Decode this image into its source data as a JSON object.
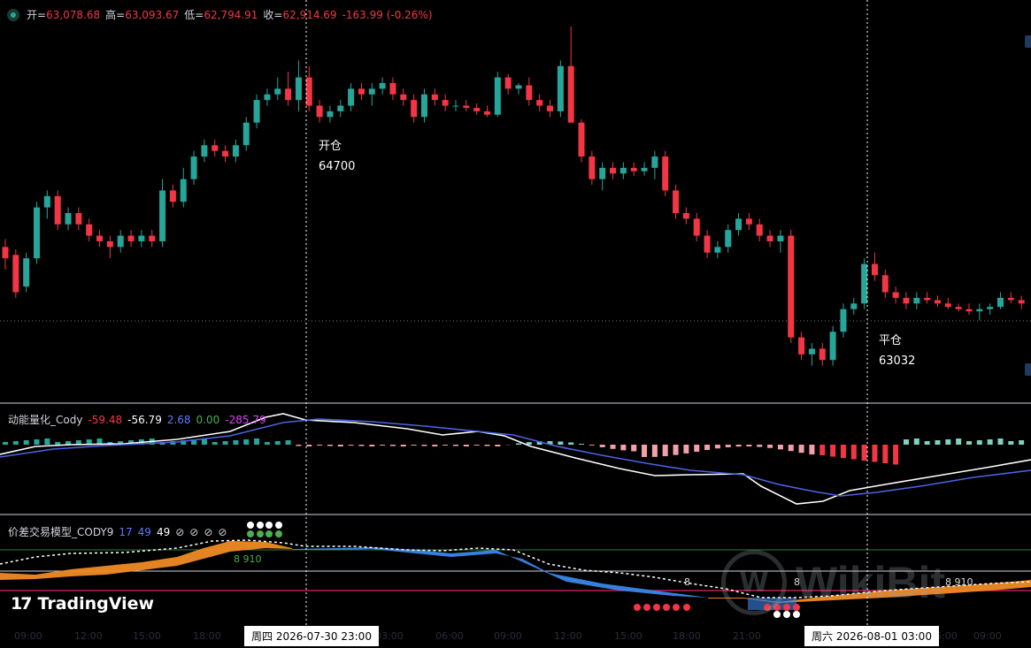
{
  "ohlc": [
    {
      "k": "开=",
      "v": "63,078.68"
    },
    {
      "k": "高=",
      "v": "63,093.67"
    },
    {
      "k": "低=",
      "v": "62,794.91"
    },
    {
      "k": "收=",
      "v": "62,914.69"
    },
    {
      "k": "",
      "v": "-163.99 (-0.26%)"
    }
  ],
  "annotations": {
    "open_label": "开仓",
    "open_price": "64700",
    "close_label": "平仓",
    "close_price": "63032"
  },
  "ind1": {
    "name": "动能量化_Cody",
    "v1": "-59.48",
    "v2": "-56.79",
    "v3": "2.68",
    "v4": "0.00",
    "v5": "-285.79",
    "colors": [
      "#f23645",
      "#ffffff",
      "#5b7bff",
      "#4caf50",
      "#e040fb"
    ]
  },
  "ind2": {
    "name": "价差交易模型_CODY9",
    "p1": "17",
    "p2": "49",
    "p3": "49",
    "icons": [
      "⊘",
      "⊘",
      "⊘",
      "⊘"
    ],
    "num_a": "8 910",
    "num_b": "8",
    "num_c": "8",
    "num_d": "8 910"
  },
  "time_badges": {
    "left": "周四 2026-07-30   23:00",
    "right": "周六 2026-08-01   03:00"
  },
  "axis_labels": [
    "09:00",
    "12:00",
    "15:00",
    "18:00",
    "03:00",
    "06:00",
    "09:00",
    "12:00",
    "15:00",
    "18:00",
    "21:00",
    "06:00",
    "09:00"
  ],
  "branding": {
    "tradingview": "TradingView",
    "wikibit": "WikiBit"
  },
  "colors": {
    "up": "#26a69a",
    "down": "#f23645",
    "background": "#000000"
  },
  "chart_data": {
    "type": "candlestick",
    "candles": [
      [
        63350,
        63420,
        63150,
        63250
      ],
      [
        63280,
        63330,
        62900,
        62950
      ],
      [
        63000,
        63300,
        62950,
        63250
      ],
      [
        63250,
        63750,
        63200,
        63700
      ],
      [
        63700,
        63850,
        63600,
        63800
      ],
      [
        63800,
        63850,
        63500,
        63550
      ],
      [
        63550,
        63700,
        63500,
        63650
      ],
      [
        63650,
        63700,
        63500,
        63550
      ],
      [
        63550,
        63600,
        63400,
        63450
      ],
      [
        63450,
        63500,
        63350,
        63400
      ],
      [
        63400,
        63450,
        63250,
        63350
      ],
      [
        63350,
        63500,
        63300,
        63450
      ],
      [
        63450,
        63500,
        63350,
        63400
      ],
      [
        63400,
        63500,
        63350,
        63450
      ],
      [
        63450,
        63500,
        63350,
        63400
      ],
      [
        63400,
        63950,
        63350,
        63850
      ],
      [
        63850,
        63900,
        63700,
        63750
      ],
      [
        63750,
        64050,
        63700,
        63950
      ],
      [
        63950,
        64200,
        63900,
        64150
      ],
      [
        64150,
        64300,
        64100,
        64250
      ],
      [
        64250,
        64300,
        64150,
        64200
      ],
      [
        64200,
        64250,
        64100,
        64150
      ],
      [
        64150,
        64300,
        64100,
        64250
      ],
      [
        64250,
        64500,
        64200,
        64450
      ],
      [
        64450,
        64700,
        64400,
        64650
      ],
      [
        64650,
        64750,
        64600,
        64700
      ],
      [
        64700,
        64850,
        64650,
        64750
      ],
      [
        64750,
        64900,
        64600,
        64650
      ],
      [
        64650,
        65000,
        64550,
        64850
      ],
      [
        64850,
        64950,
        64550,
        64600
      ],
      [
        64600,
        64650,
        64450,
        64500
      ],
      [
        64500,
        64600,
        64450,
        64550
      ],
      [
        64550,
        64650,
        64500,
        64600
      ],
      [
        64600,
        64800,
        64550,
        64750
      ],
      [
        64750,
        64800,
        64650,
        64700
      ],
      [
        64700,
        64800,
        64600,
        64750
      ],
      [
        64750,
        64850,
        64700,
        64800
      ],
      [
        64800,
        64850,
        64650,
        64700
      ],
      [
        64700,
        64750,
        64600,
        64650
      ],
      [
        64650,
        64700,
        64450,
        64500
      ],
      [
        64500,
        64750,
        64450,
        64700
      ],
      [
        64700,
        64750,
        64600,
        64650
      ],
      [
        64650,
        64700,
        64550,
        64600
      ],
      [
        64600,
        64650,
        64550,
        64600
      ],
      [
        64600,
        64650,
        64550,
        64580
      ],
      [
        64580,
        64620,
        64520,
        64550
      ],
      [
        64550,
        64600,
        64500,
        64520
      ],
      [
        64520,
        64900,
        64500,
        64850
      ],
      [
        64850,
        64880,
        64700,
        64750
      ],
      [
        64750,
        64800,
        64700,
        64780
      ],
      [
        64780,
        64850,
        64600,
        64650
      ],
      [
        64650,
        64700,
        64550,
        64600
      ],
      [
        64600,
        64650,
        64500,
        64550
      ],
      [
        64550,
        65000,
        64500,
        64950
      ],
      [
        64950,
        65300,
        64450,
        64450
      ],
      [
        64450,
        64480,
        64100,
        64150
      ],
      [
        64150,
        64200,
        63900,
        63950
      ],
      [
        63950,
        64100,
        63850,
        64050
      ],
      [
        64050,
        64100,
        63950,
        64000
      ],
      [
        64000,
        64100,
        63950,
        64050
      ],
      [
        64050,
        64100,
        63980,
        64020
      ],
      [
        64020,
        64100,
        63980,
        64050
      ],
      [
        64050,
        64200,
        63950,
        64150
      ],
      [
        64150,
        64200,
        63800,
        63850
      ],
      [
        63850,
        63900,
        63600,
        63650
      ],
      [
        63650,
        63700,
        63550,
        63600
      ],
      [
        63600,
        63650,
        63400,
        63450
      ],
      [
        63450,
        63500,
        63250,
        63300
      ],
      [
        63300,
        63400,
        63250,
        63350
      ],
      [
        63350,
        63550,
        63300,
        63500
      ],
      [
        63500,
        63650,
        63450,
        63600
      ],
      [
        63600,
        63650,
        63500,
        63550
      ],
      [
        63550,
        63600,
        63400,
        63450
      ],
      [
        63450,
        63500,
        63350,
        63400
      ],
      [
        63400,
        63500,
        63300,
        63450
      ],
      [
        63450,
        63500,
        62500,
        62550
      ],
      [
        62550,
        62600,
        62350,
        62400
      ],
      [
        62400,
        62500,
        62300,
        62450
      ],
      [
        62450,
        62500,
        62300,
        62350
      ],
      [
        62350,
        62650,
        62300,
        62600
      ],
      [
        62600,
        62850,
        62550,
        62800
      ],
      [
        62800,
        62900,
        62750,
        62850
      ],
      [
        62850,
        63250,
        62800,
        63200
      ],
      [
        63200,
        63300,
        63050,
        63100
      ],
      [
        63100,
        63150,
        62900,
        62950
      ],
      [
        62950,
        63000,
        62850,
        62900
      ],
      [
        62900,
        62950,
        62800,
        62850
      ],
      [
        62850,
        62950,
        62800,
        62900
      ],
      [
        62900,
        62950,
        62850,
        62880
      ],
      [
        62880,
        62920,
        62820,
        62850
      ],
      [
        62850,
        62900,
        62800,
        62820
      ],
      [
        62820,
        62850,
        62780,
        62800
      ],
      [
        62800,
        62850,
        62750,
        62780
      ],
      [
        62780,
        62850,
        62700,
        62800
      ],
      [
        62800,
        62850,
        62750,
        62820
      ],
      [
        62820,
        62950,
        62800,
        62900
      ],
      [
        62900,
        62950,
        62850,
        62880
      ],
      [
        62880,
        62920,
        62800,
        62850
      ]
    ],
    "ylim": [
      62000,
      65300
    ]
  }
}
